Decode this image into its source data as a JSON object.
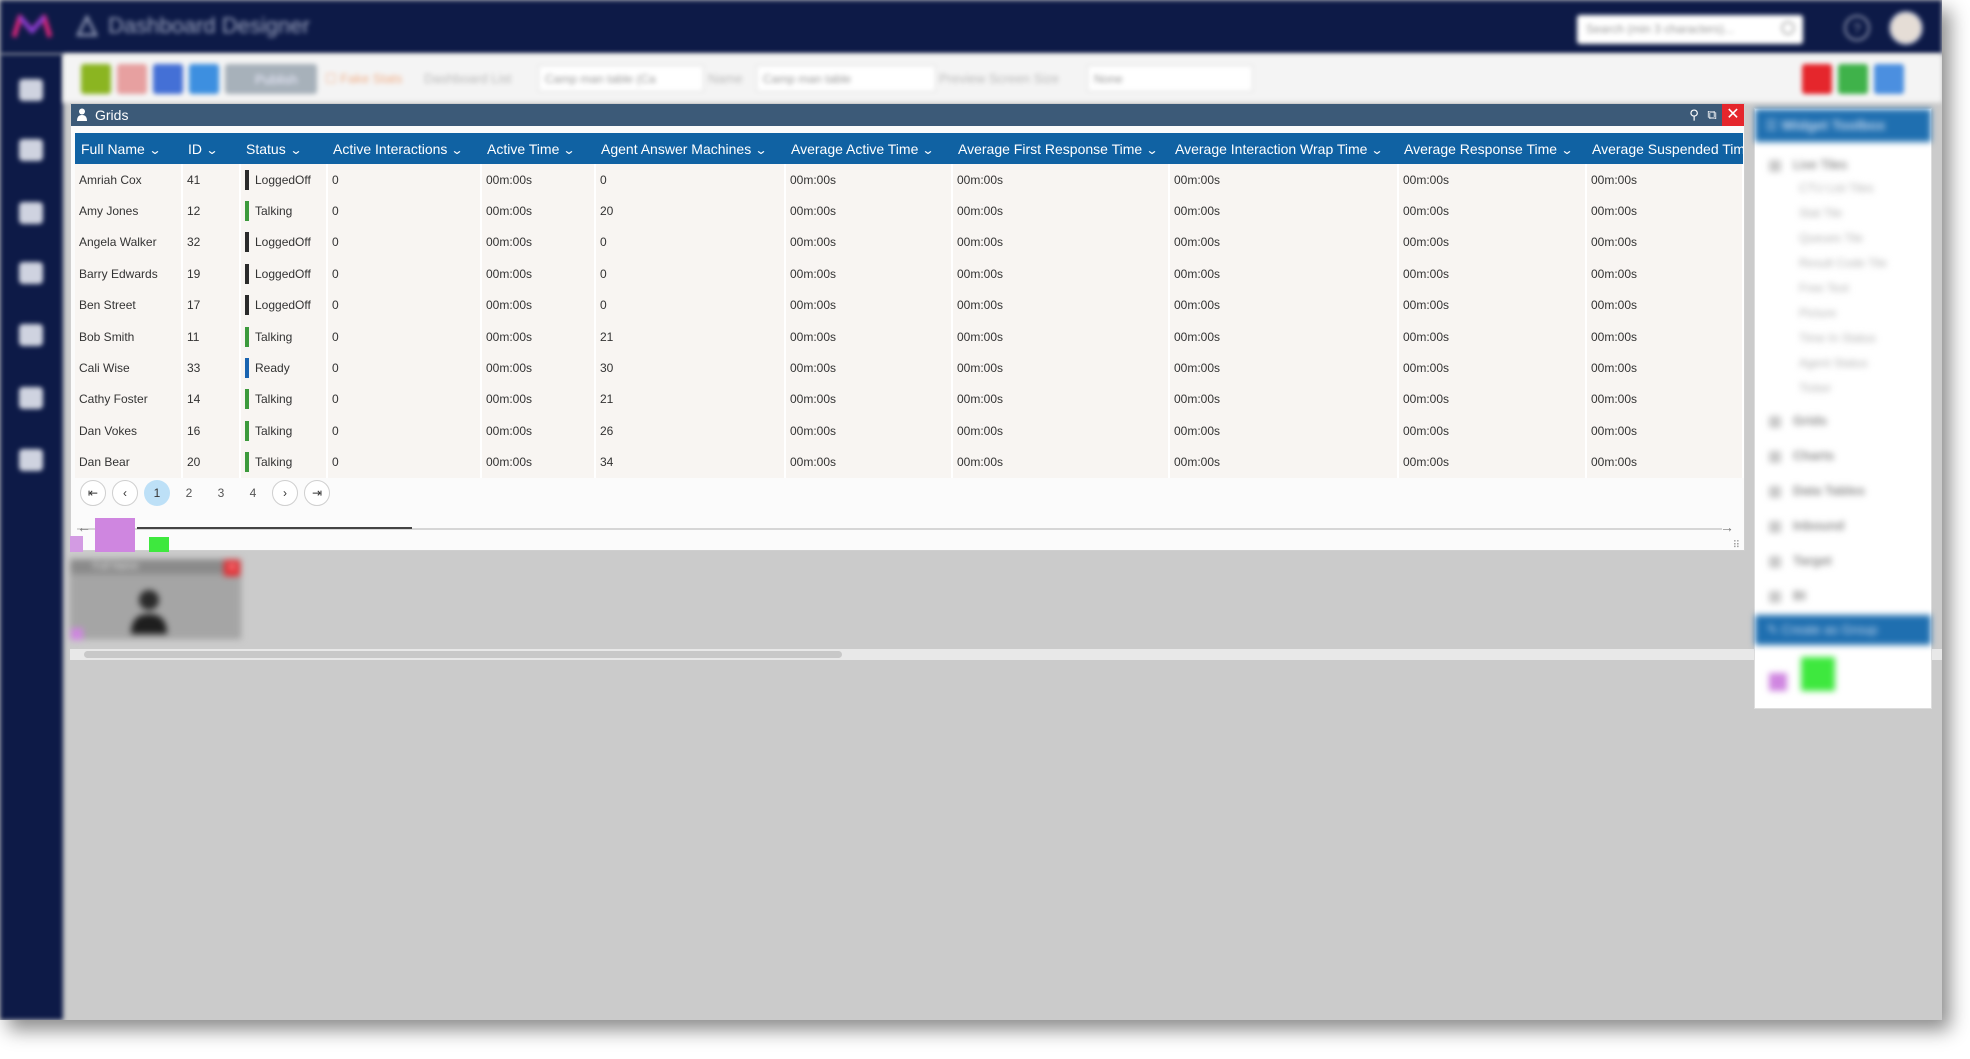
{
  "app": {
    "title": "Dashboard Designer"
  },
  "search": {
    "placeholder": "Search (min 3 characters)..."
  },
  "toolbar": {
    "fake_stats_label": "Fake Stats",
    "dashboard_list_label": "Dashboard List",
    "dashboard_list_value": "Camp man table (Ca",
    "name_label": "Name",
    "name_value": "Camp man table",
    "preview_size_label": "Preview Screen Size",
    "preview_size_value": "None",
    "publish_label": "Publish"
  },
  "grid_widget": {
    "title": "Grids",
    "columns": [
      "Full Name",
      "ID",
      "Status",
      "Active Interactions",
      "Active Time",
      "Agent Answer Machines",
      "Average Active Time",
      "Average First Response Time",
      "Average Interaction Wrap Time",
      "Average Response Time",
      "Average Suspended Time"
    ],
    "rows": [
      {
        "name": "Amriah Cox",
        "id": "41",
        "status": "LoggedOff",
        "status_color": "#2b2b2b",
        "active_interactions": "0",
        "active_time": "00m:00s",
        "answer_machines": "0",
        "avg_active": "00m:00s",
        "avg_first_response": "00m:00s",
        "avg_wrap": "00m:00s",
        "avg_response": "00m:00s",
        "avg_suspended": "00m:00s"
      },
      {
        "name": "Amy Jones",
        "id": "12",
        "status": "Talking",
        "status_color": "#3c9a3c",
        "active_interactions": "0",
        "active_time": "00m:00s",
        "answer_machines": "20",
        "avg_active": "00m:00s",
        "avg_first_response": "00m:00s",
        "avg_wrap": "00m:00s",
        "avg_response": "00m:00s",
        "avg_suspended": "00m:00s"
      },
      {
        "name": "Angela Walker",
        "id": "32",
        "status": "LoggedOff",
        "status_color": "#2b2b2b",
        "active_interactions": "0",
        "active_time": "00m:00s",
        "answer_machines": "0",
        "avg_active": "00m:00s",
        "avg_first_response": "00m:00s",
        "avg_wrap": "00m:00s",
        "avg_response": "00m:00s",
        "avg_suspended": "00m:00s"
      },
      {
        "name": "Barry Edwards",
        "id": "19",
        "status": "LoggedOff",
        "status_color": "#2b2b2b",
        "active_interactions": "0",
        "active_time": "00m:00s",
        "answer_machines": "0",
        "avg_active": "00m:00s",
        "avg_first_response": "00m:00s",
        "avg_wrap": "00m:00s",
        "avg_response": "00m:00s",
        "avg_suspended": "00m:00s"
      },
      {
        "name": "Ben Street",
        "id": "17",
        "status": "LoggedOff",
        "status_color": "#2b2b2b",
        "active_interactions": "0",
        "active_time": "00m:00s",
        "answer_machines": "0",
        "avg_active": "00m:00s",
        "avg_first_response": "00m:00s",
        "avg_wrap": "00m:00s",
        "avg_response": "00m:00s",
        "avg_suspended": "00m:00s"
      },
      {
        "name": "Bob Smith",
        "id": "11",
        "status": "Talking",
        "status_color": "#3c9a3c",
        "active_interactions": "0",
        "active_time": "00m:00s",
        "answer_machines": "21",
        "avg_active": "00m:00s",
        "avg_first_response": "00m:00s",
        "avg_wrap": "00m:00s",
        "avg_response": "00m:00s",
        "avg_suspended": "00m:00s"
      },
      {
        "name": "Cali Wise",
        "id": "33",
        "status": "Ready",
        "status_color": "#1a64b0",
        "active_interactions": "0",
        "active_time": "00m:00s",
        "answer_machines": "30",
        "avg_active": "00m:00s",
        "avg_first_response": "00m:00s",
        "avg_wrap": "00m:00s",
        "avg_response": "00m:00s",
        "avg_suspended": "00m:00s"
      },
      {
        "name": "Cathy Foster",
        "id": "14",
        "status": "Talking",
        "status_color": "#3c9a3c",
        "active_interactions": "0",
        "active_time": "00m:00s",
        "answer_machines": "21",
        "avg_active": "00m:00s",
        "avg_first_response": "00m:00s",
        "avg_wrap": "00m:00s",
        "avg_response": "00m:00s",
        "avg_suspended": "00m:00s"
      },
      {
        "name": "Dan Vokes",
        "id": "16",
        "status": "Talking",
        "status_color": "#3c9a3c",
        "active_interactions": "0",
        "active_time": "00m:00s",
        "answer_machines": "26",
        "avg_active": "00m:00s",
        "avg_first_response": "00m:00s",
        "avg_wrap": "00m:00s",
        "avg_response": "00m:00s",
        "avg_suspended": "00m:00s"
      },
      {
        "name": "Dan Bear",
        "id": "20",
        "status": "Talking",
        "status_color": "#3c9a3c",
        "active_interactions": "0",
        "active_time": "00m:00s",
        "answer_machines": "34",
        "avg_active": "00m:00s",
        "avg_first_response": "00m:00s",
        "avg_wrap": "00m:00s",
        "avg_response": "00m:00s",
        "avg_suspended": "00m:00s"
      }
    ],
    "pages": [
      "1",
      "2",
      "3",
      "4"
    ],
    "current_page": "1"
  },
  "mini_widget": {
    "title": "Full Name"
  },
  "toolbox": {
    "title": "Widget Toolbox",
    "live_tiles": "Live Tiles",
    "live_tile_items": [
      "CTU List Tiles",
      "Stat Tile",
      "Queues Tile",
      "Result Code Tile",
      "Free Text",
      "Picture",
      "Time In Status",
      "Agent Status",
      "Ticker"
    ],
    "categories": [
      "Grids",
      "Charts",
      "Data Tables",
      "Inbound",
      "Target",
      "BI"
    ],
    "create_group": "Create as Group"
  },
  "colors": {
    "nav_bg": "#0d1a47",
    "header_blue": "#1062a3",
    "close_red": "#e5262c",
    "accent_green": "#3ee83e",
    "accent_purple": "#cf86e0"
  }
}
